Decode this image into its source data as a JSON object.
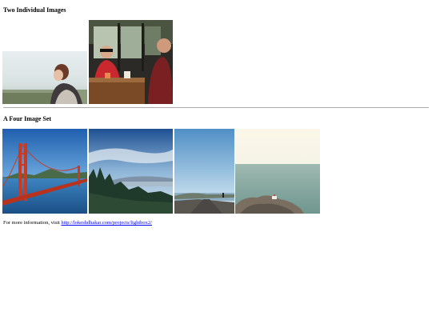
{
  "sections": [
    {
      "title": "Two Individual Images"
    },
    {
      "title": "A Four Image Set"
    }
  ],
  "images": {
    "woman_looking_away": "woman-looking-away-thumbnail",
    "friends_at_cafe": "friends-at-cafe-thumbnail",
    "golden_gate_bridge": "golden-gate-bridge-thumbnail",
    "forest_overlook": "forest-overlook-thumbnail",
    "road_by_sea": "road-by-sea-thumbnail",
    "rocky_coastline": "rocky-coastline-thumbnail"
  },
  "footer": {
    "text": "For more information, visit ",
    "link_text": "http://lokeshdhakar.com/projects/lightbox2/"
  },
  "colors": {
    "link": "#0000ee",
    "divider": "#aaaaaa"
  }
}
